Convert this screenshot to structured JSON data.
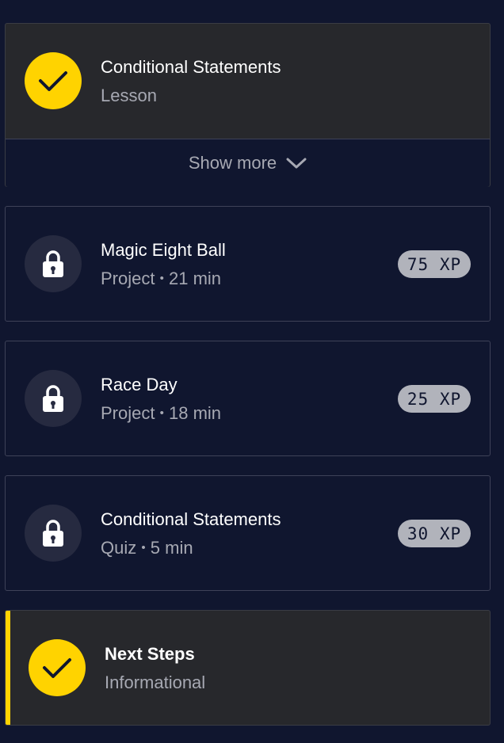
{
  "items": [
    {
      "title": "Conditional Statements",
      "subtitle": "Lesson",
      "status": "completed",
      "icon": "check-icon",
      "show_more_label": "Show more"
    },
    {
      "title": "Magic Eight Ball",
      "type": "Project",
      "separator": "•",
      "duration": "21 min",
      "xp": "75 XP",
      "status": "locked",
      "icon": "lock-icon"
    },
    {
      "title": "Race Day",
      "type": "Project",
      "separator": "•",
      "duration": "18 min",
      "xp": "25 XP",
      "status": "locked",
      "icon": "lock-icon"
    },
    {
      "title": "Conditional Statements",
      "type": "Quiz",
      "separator": "•",
      "duration": "5 min",
      "xp": "30 XP",
      "status": "locked",
      "icon": "lock-icon"
    },
    {
      "title": "Next Steps",
      "subtitle": "Informational",
      "status": "completed",
      "icon": "check-icon"
    }
  ],
  "colors": {
    "background": "#10162f",
    "completed_card": "#27282c",
    "accent_yellow": "#ffd300",
    "xp_badge": "#b1b3bb",
    "muted_text": "#a7a9b3"
  }
}
